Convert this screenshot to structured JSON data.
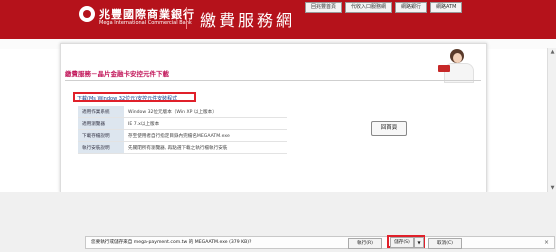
{
  "header": {
    "bank_name_cn": "兆豐國際商業銀行",
    "bank_name_en": "Mega International Commercial Bank",
    "site_title": "繳費服務網",
    "nav": [
      "回兆豐首頁",
      "代收入口服務網",
      "網路銀行",
      "網路ATM"
    ]
  },
  "content": {
    "title": "繳費服務－晶片金融卡安控元件下載",
    "download_link": "下載(Ms Window 32位元)安控元件安裝程式",
    "info_rows": [
      {
        "label": "適用作業系統",
        "value": "Window 32位元版本（Win XP 以上版本）"
      },
      {
        "label": "適用瀏覽器",
        "value": "IE 7.x以上版本"
      },
      {
        "label": "下載存檔說明",
        "value": "存至使用者自行指定目錄內完檔名MEGAATM.exe"
      },
      {
        "label": "執行安裝說明",
        "value": "先關閉所有瀏覽器, 再點選下載之執行檔執行安裝"
      }
    ],
    "home_button": "回首頁"
  },
  "download_bar": {
    "message": "您要執行或儲存來自 mega-payment.com.tw 的 MEGAATM.exe (379 KB)?",
    "open_label": "執行(R)",
    "save_label": "儲存(S)",
    "save_arrow": "▼",
    "cancel_label": "取消(C)",
    "close_icon": "×"
  },
  "colors": {
    "brand_red": "#b5121b",
    "title_pink": "#c2185b",
    "highlight_red": "#e0202a",
    "link_blue": "#123f8c"
  }
}
